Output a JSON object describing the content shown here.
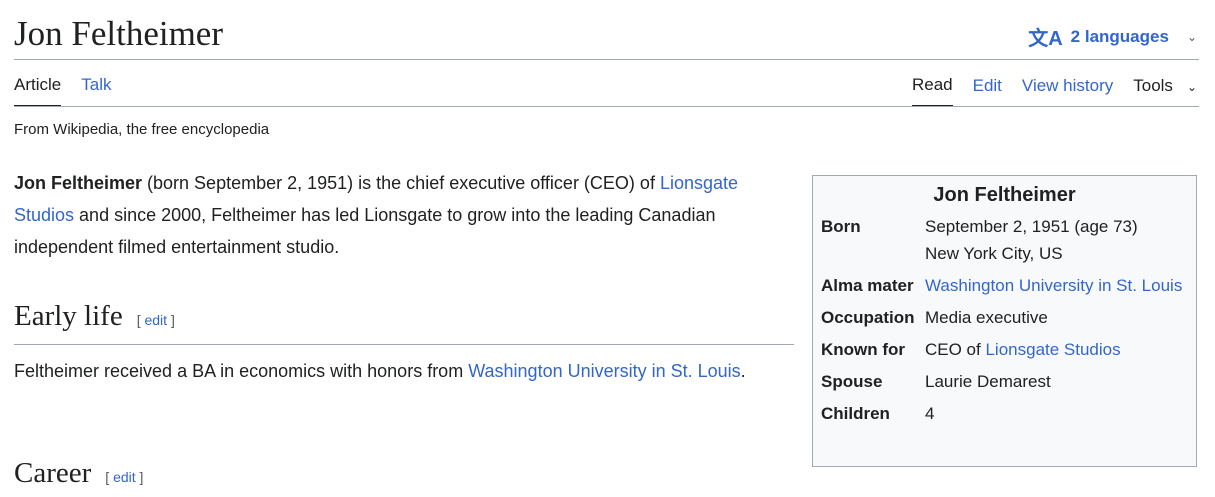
{
  "header": {
    "title": "Jon Feltheimer",
    "languages_label": "2 languages"
  },
  "tabs": {
    "left": [
      "Article",
      "Talk"
    ],
    "right": [
      "Read",
      "Edit",
      "View history",
      "Tools"
    ]
  },
  "tagline": "From Wikipedia, the free encyclopedia",
  "lead": {
    "bold_name": "Jon Feltheimer",
    "text1": " (born September 2, 1951) is the chief executive officer (CEO) of ",
    "link1": "Lionsgate Studios",
    "text2": " and since 2000, Feltheimer has led Lionsgate to grow into the leading Canadian independent filmed entertainment studio."
  },
  "sections": {
    "early_life": {
      "heading": "Early life",
      "edit_open": "[",
      "edit_label": "edit",
      "edit_close": "]",
      "text1": "Feltheimer received a BA in economics with honors from ",
      "link1": "Washington University in St. Louis",
      "text2": "."
    },
    "career": {
      "heading": "Career",
      "edit_open": "[",
      "edit_label": "edit",
      "edit_close": "]"
    }
  },
  "infobox": {
    "title": "Jon Feltheimer",
    "born_label": "Born",
    "born_value_line1": "September 2, 1951 (age 73)",
    "born_value_line2": "New York City, US",
    "alma_label": "Alma mater",
    "alma_value": "Washington University in St. Louis",
    "occupation_label": "Occupation",
    "occupation_value": "Media executive",
    "known_label": "Known for",
    "known_prefix": "CEO of ",
    "known_link": "Lionsgate Studios",
    "spouse_label": "Spouse",
    "spouse_value": "Laurie Demarest",
    "children_label": "Children",
    "children_value": "4"
  },
  "colors": {
    "link": "#3366cc",
    "text": "#202122",
    "rule": "#a2a9b1",
    "infobox_bg": "#f8f9fa"
  }
}
